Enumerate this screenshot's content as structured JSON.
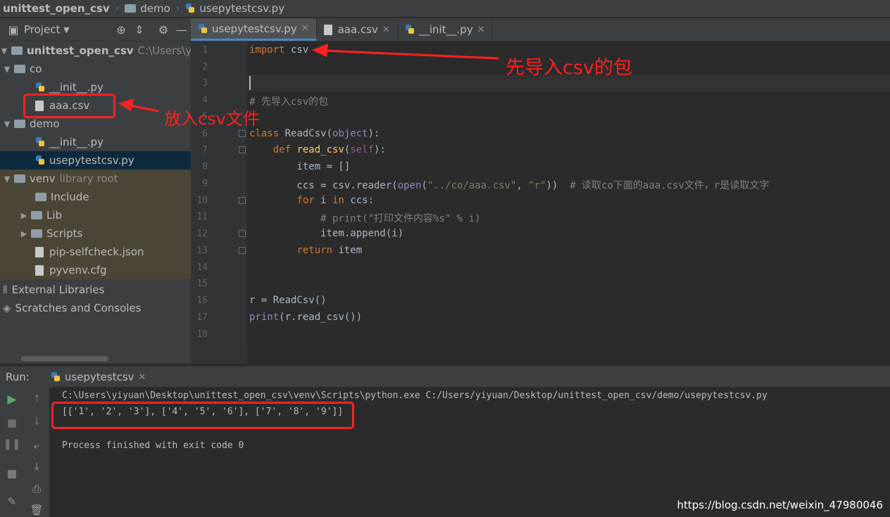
{
  "breadcrumb": [
    "unittest_open_csv",
    "demo",
    "usepytestcsv.py"
  ],
  "project_toolbar": {
    "label": "Project"
  },
  "tabs": [
    {
      "label": "usepytestcsv.py",
      "active": true
    },
    {
      "label": "aaa.csv",
      "active": false
    },
    {
      "label": "__init__.py",
      "active": false
    }
  ],
  "tree": {
    "root": {
      "label": "unittest_open_csv",
      "path": "C:\\Users\\yiyua"
    },
    "co": "co",
    "co_init": "__init__.py",
    "aaa_csv": "aaa.csv",
    "demo": "demo",
    "demo_init": "__init__.py",
    "usepytestcsv": "usepytestcsv.py",
    "venv": "venv",
    "venv_note": "library root",
    "include": "Include",
    "lib": "Lib",
    "scripts": "Scripts",
    "pipcheck": "pip-selfcheck.json",
    "pyvenv": "pyvenv.cfg",
    "external": "External Libraries",
    "scratches": "Scratches and Consoles"
  },
  "editor": {
    "line_numbers": [
      "1",
      "2",
      "3",
      "4",
      "5",
      "6",
      "7",
      "8",
      "9",
      "10",
      "11",
      "12",
      "13",
      "14",
      "15",
      "16",
      "17",
      "18"
    ]
  },
  "annotations": {
    "import_note": "先导入csv的包",
    "file_note": "放入csv文件"
  },
  "run": {
    "label": "Run:",
    "tab": "usepytestcsv",
    "cmd": "C:\\Users\\yiyuan\\Desktop\\unittest_open_csv\\venv\\Scripts\\python.exe C:/Users/yiyuan/Desktop/unittest_open_csv/demo/usepytestcsv.py",
    "output": "[['1', '2', '3'], ['4', '5', '6'], ['7', '8', '9']]",
    "finish": "Process finished with exit code 0"
  },
  "watermark": "https://blog.csdn.net/weixin_47980046",
  "colors": {
    "accent": "#4a88c7",
    "annotation": "#ff2020",
    "selection": "#0d293e"
  }
}
